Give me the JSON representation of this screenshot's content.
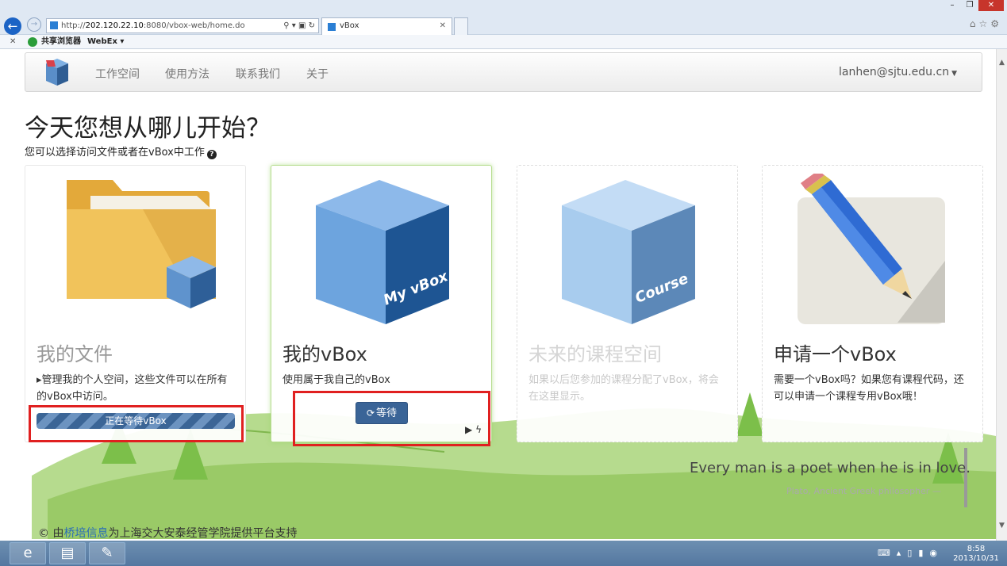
{
  "browser": {
    "url_prefix": "http://",
    "url_host": "202.120.22.10",
    "url_rest": ":8080/vbox-web/home.do",
    "tab_title": "vBox",
    "favorites": [
      "共享浏览器",
      "WebEx ▾"
    ]
  },
  "nav": {
    "items": [
      "工作空间",
      "使用方法",
      "联系我们",
      "关于"
    ],
    "user": "lanhen@sjtu.edu.cn"
  },
  "page": {
    "headline": "今天您想从哪儿开始？",
    "subtitle": "您可以选择访问文件或者在vBox中工作"
  },
  "cards": [
    {
      "title": "我的文件",
      "desc": "▸管理我的个人空间，这些文件可以在所有的vBox中访问。",
      "progress_label": "正在等待vBox"
    },
    {
      "title": "我的vBox",
      "desc": "使用属于我自己的vBox",
      "button_label": "等待",
      "cube_label": "My vBox"
    },
    {
      "title": "未来的课程空间",
      "desc": "如果以后您参加的课程分配了vBox，将会在这里显示。",
      "cube_label": "Course"
    },
    {
      "title": "申请一个vBox",
      "desc": "需要一个vBox吗？如果您有课程代码，还可以申请一个课程专用vBox哦！"
    }
  ],
  "quote": {
    "text": "Every man is a poet when he is in love.",
    "attribution": "Plato, Ancient Greek philosopher —"
  },
  "footer": {
    "prefix": "© 由",
    "link": "桥培信息",
    "suffix": "为上海交大安泰经管学院提供平台支持"
  },
  "taskbar": {
    "time": "8:58",
    "date": "2013/10/31"
  },
  "colors": {
    "primary": "#3a6497",
    "highlight": "#e02020",
    "folder": "#f0c35a",
    "cube": "#6a9ed8"
  }
}
